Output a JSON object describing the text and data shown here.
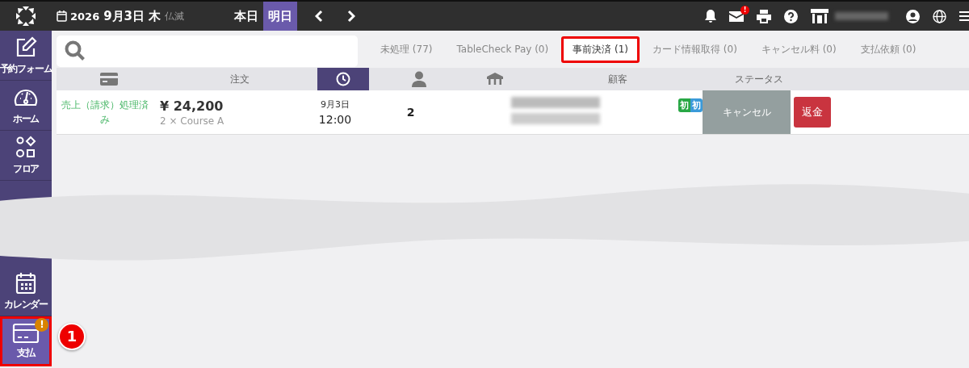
{
  "topbar": {
    "year": "2026",
    "date": "9月3日",
    "weekday": "木",
    "rokuyo": "仏滅",
    "day_buttons": [
      {
        "label": "本日",
        "selected": false
      },
      {
        "label": "明日",
        "selected": true
      }
    ],
    "mail_badge": "!"
  },
  "sidebar": {
    "items": [
      {
        "label": "予約フォーム",
        "kind": "edit",
        "selected": false,
        "highlighted": false
      },
      {
        "label": "ホーム",
        "kind": "gauge",
        "selected": false,
        "highlighted": false
      },
      {
        "label": "フロア",
        "kind": "shapes",
        "selected": false,
        "highlighted": false
      },
      {
        "label": "カレンダー",
        "kind": "calendar",
        "selected": false,
        "highlighted": false
      },
      {
        "label": "支払",
        "kind": "card",
        "selected": true,
        "highlighted": true,
        "badge": "!"
      }
    ]
  },
  "callout": "1",
  "tabs": [
    {
      "label": "未処理 (77)",
      "selected": false,
      "highlighted": false
    },
    {
      "label": "TableCheck Pay (0)",
      "selected": false,
      "highlighted": false
    },
    {
      "label": "事前決済 (1)",
      "selected": true,
      "highlighted": true
    },
    {
      "label": "カード情報取得 (0)",
      "selected": false,
      "highlighted": false
    },
    {
      "label": "キャンセル料 (0)",
      "selected": false,
      "highlighted": false
    },
    {
      "label": "支払依頼 (0)",
      "selected": false,
      "highlighted": false
    }
  ],
  "columns": [
    {
      "kind": "card",
      "selected": false
    },
    {
      "kind": "text",
      "label": "注文",
      "selected": false
    },
    {
      "kind": "clock",
      "selected": true
    },
    {
      "kind": "person",
      "selected": false
    },
    {
      "kind": "table",
      "selected": false
    },
    {
      "kind": "text",
      "label": "顧客",
      "selected": false
    },
    {
      "kind": "text",
      "label": "ステータス",
      "selected": false
    }
  ],
  "rows": [
    {
      "payment_status": "売上（請求）処理済み",
      "amount": "¥ 24,200",
      "items": "2 × Course A",
      "date": "9月3日",
      "time": "12:00",
      "party": "2",
      "tags": [
        {
          "label": "初",
          "color": "#28a745"
        },
        {
          "label": "初",
          "color": "#3a9ad9"
        }
      ],
      "status": "キャンセル",
      "action": "返金"
    }
  ]
}
